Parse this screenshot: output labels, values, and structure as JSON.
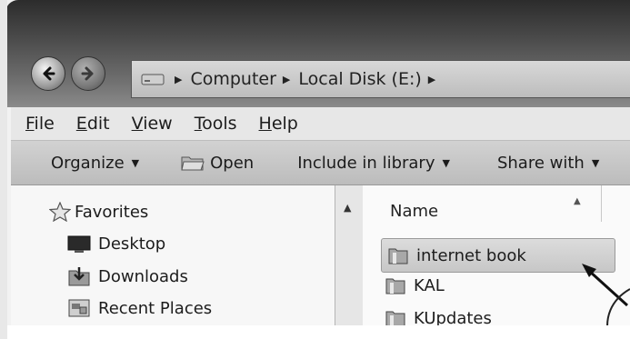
{
  "navigation": {
    "back_icon": "back-arrow-icon",
    "forward_icon": "forward-arrow-icon"
  },
  "address_bar": {
    "drive_icon": "drive-icon",
    "segments": [
      "Computer",
      "Local Disk (E:)"
    ]
  },
  "menu": {
    "items": [
      {
        "first": "F",
        "rest": "ile"
      },
      {
        "first": "E",
        "rest": "dit"
      },
      {
        "first": "V",
        "rest": "iew"
      },
      {
        "first": "T",
        "rest": "ools"
      },
      {
        "first": "H",
        "rest": "elp"
      }
    ]
  },
  "toolbar": {
    "organize": "Organize",
    "open": "Open",
    "include_in_library": "Include in library",
    "share_with": "Share with"
  },
  "sidebar": {
    "items": [
      {
        "label": "Favorites",
        "icon": "star-icon"
      },
      {
        "label": "Desktop",
        "icon": "desktop-icon"
      },
      {
        "label": "Downloads",
        "icon": "downloads-icon"
      },
      {
        "label": "Recent Places",
        "icon": "recent-places-icon"
      }
    ]
  },
  "file_list": {
    "column_name": "Name",
    "items": [
      {
        "label": "internet book",
        "icon": "folder-icon",
        "selected": true
      },
      {
        "label": "KAL",
        "icon": "folder-icon",
        "selected": false
      },
      {
        "label": "KUpdates",
        "icon": "folder-icon",
        "selected": false
      }
    ]
  },
  "colors": {
    "titlebar": "#3c3c3c",
    "selection": "#cfcfcf"
  }
}
